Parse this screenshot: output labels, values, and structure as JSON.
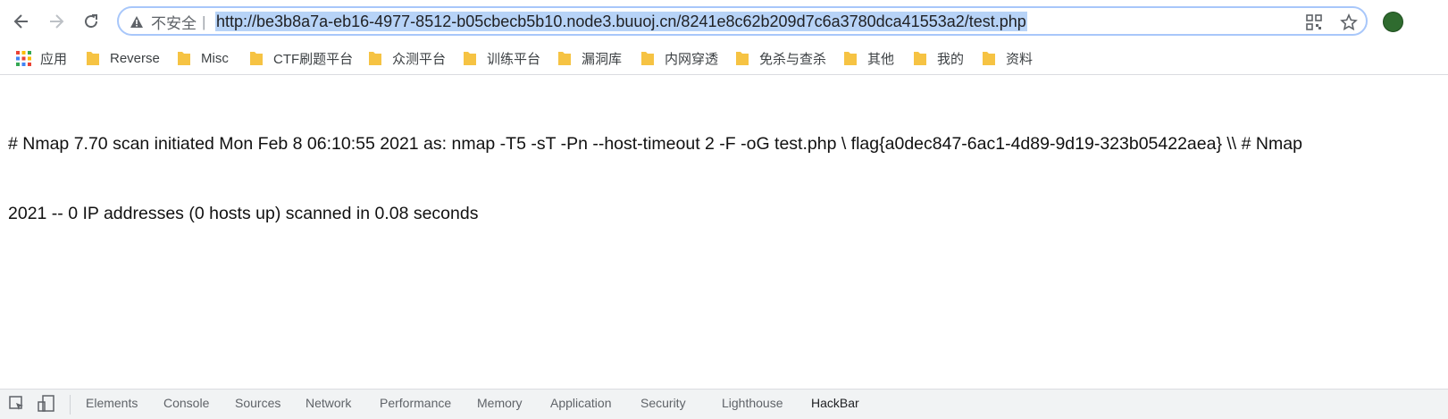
{
  "browser": {
    "security_label": "不安全",
    "separator": "|",
    "url": "http://be3b8a7a-eb16-4977-8512-b05cbecb5b10.node3.buuoj.cn/8241e8c62b209d7c6a3780dca41553a2/test.php"
  },
  "bookmarks": [
    {
      "label": "应用",
      "icon": "apps-grid-icon"
    },
    {
      "label": "Reverse",
      "icon": "folder-icon"
    },
    {
      "label": "Misc",
      "icon": "folder-icon"
    },
    {
      "label": "CTF刷题平台",
      "icon": "folder-icon"
    },
    {
      "label": "众测平台",
      "icon": "folder-icon"
    },
    {
      "label": "训练平台",
      "icon": "folder-icon"
    },
    {
      "label": "漏洞库",
      "icon": "folder-icon"
    },
    {
      "label": "内网穿透",
      "icon": "folder-icon"
    },
    {
      "label": "免杀与查杀",
      "icon": "folder-icon"
    },
    {
      "label": "其他",
      "icon": "folder-icon"
    },
    {
      "label": "我的",
      "icon": "folder-icon"
    },
    {
      "label": "资料",
      "icon": "folder-icon"
    }
  ],
  "page": {
    "line1": "# Nmap 7.70 scan initiated Mon Feb 8 06:10:55 2021 as: nmap -T5 -sT -Pn --host-timeout 2 -F -oG test.php \\ flag{a0dec847-6ac1-4d89-9d19-323b05422aea} \\\\ # Nmap",
    "line2": "2021 -- 0 IP addresses (0 hosts up) scanned in 0.08 seconds"
  },
  "devtools": {
    "tabs": [
      "Elements",
      "Console",
      "Sources",
      "Network",
      "Performance",
      "Memory",
      "Application",
      "Security",
      "Lighthouse",
      "HackBar"
    ],
    "active_tab": "HackBar"
  },
  "colors": {
    "url_highlight": "#b7d3f7",
    "omnibox_border": "#a8c7fa",
    "folder": "#f6c343"
  }
}
